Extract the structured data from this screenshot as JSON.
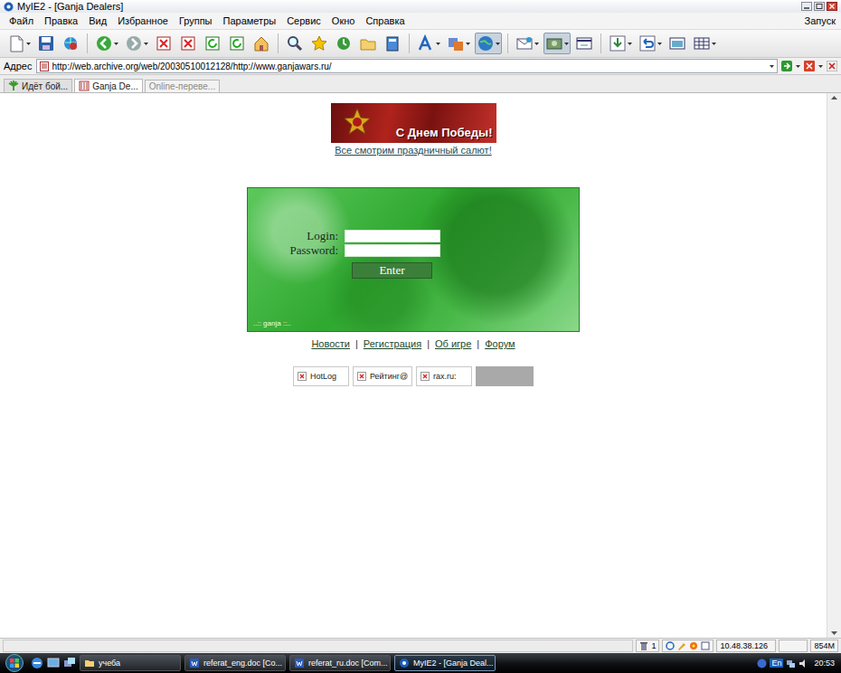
{
  "window": {
    "title": "MyIE2 - [Ganja Dealers]"
  },
  "menu": {
    "items": [
      "Файл",
      "Правка",
      "Вид",
      "Избранное",
      "Группы",
      "Параметры",
      "Сервис",
      "Окно",
      "Справка"
    ],
    "right": "Запуск"
  },
  "address": {
    "label": "Адрес",
    "url": "http://web.archive.org/web/20030510012128/http://www.ganjawars.ru/"
  },
  "tabs": [
    {
      "label": "Идёт бой...",
      "selected": false,
      "dimmed": false
    },
    {
      "label": "Ganja De...",
      "selected": true,
      "dimmed": false
    },
    {
      "label": "Online-переве...",
      "selected": false,
      "dimmed": true
    }
  ],
  "page": {
    "banner": {
      "text": "С Днем Победы!"
    },
    "banner_link": "Все смотрим праздничный салют!",
    "login": {
      "login_label": "Login:",
      "password_label": "Password:",
      "button": "Enter",
      "footer": "..:: ganja ::.."
    },
    "nav": {
      "links": [
        "Новости",
        "Регистрация",
        "Об игре",
        "Форум"
      ],
      "separator": "|"
    },
    "counters": [
      {
        "label": "HotLog"
      },
      {
        "label": "Рейтинг@"
      },
      {
        "label": "rax.ru:"
      }
    ]
  },
  "status_bar": {
    "count": "1",
    "ip": "10.48.38.126",
    "memory": "854M"
  },
  "taskbar": {
    "tasks": [
      {
        "label": "учеба",
        "selected": false
      },
      {
        "label": "referat_eng.doc [Co...",
        "selected": false
      },
      {
        "label": "referat_ru.doc [Com...",
        "selected": false
      },
      {
        "label": "MyIE2 - [Ganja Deal...",
        "selected": true
      }
    ],
    "language": "En",
    "time": "20:53"
  }
}
